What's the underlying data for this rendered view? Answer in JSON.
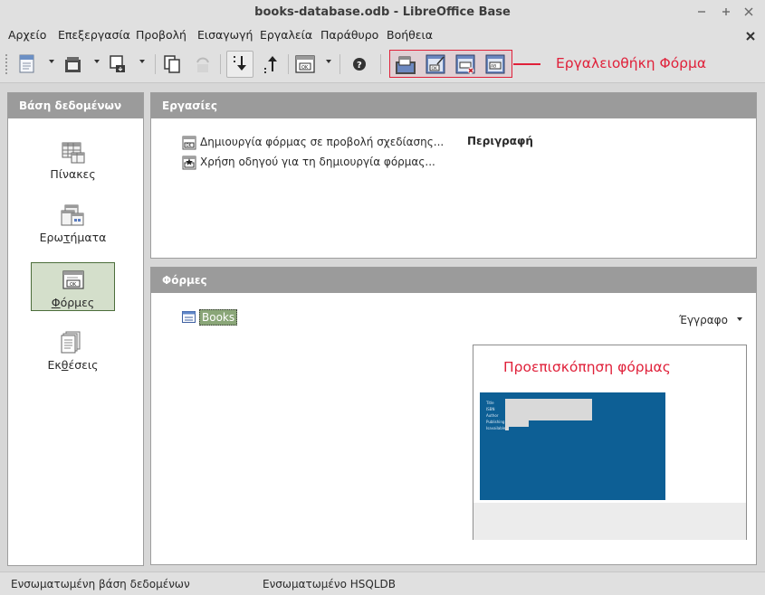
{
  "window": {
    "title": "books-database.odb - LibreOffice Base"
  },
  "menu": {
    "items": [
      "Αρχείο",
      "Επεξεργασία",
      "Προβολή",
      "Εισαγωγή",
      "Εργαλεία",
      "Παράθυρο",
      "Βοήθεια"
    ]
  },
  "toolbar": {
    "annotation": "Εργαλειοθήκη Φόρμα",
    "annotation_color": "#e0213a"
  },
  "database_panel": {
    "header": "Βάση δεδομένων",
    "categories": [
      {
        "label": "Πίνακες",
        "icon": "tables-icon",
        "selected": false
      },
      {
        "label": "Ερωτήματα",
        "icon": "queries-icon",
        "selected": false
      },
      {
        "label": "Φόρμες",
        "icon": "forms-icon",
        "selected": true
      },
      {
        "label": "Εκθέσεις",
        "icon": "reports-icon",
        "selected": false
      }
    ]
  },
  "tasks_panel": {
    "header": "Εργασίες",
    "items": [
      "Δημιουργία φόρμας σε προβολή σχεδίασης...",
      "Χρήση οδηγού για τη δημιουργία φόρμας..."
    ],
    "description_label": "Περιγραφή"
  },
  "forms_panel": {
    "header": "Φόρμες",
    "items": [
      "Books"
    ],
    "preview_mode": "Έγγραφο",
    "preview_annotation": "Προεπισκόπηση φόρμας",
    "preview_fields": [
      "Title",
      "ISBN",
      "Author",
      "Publishing",
      "Isavailable"
    ]
  },
  "statusbar": {
    "database_type": "Ενσωματωμένη βάση δεδομένων",
    "engine": "Ενσωματωμένο HSQLDB"
  },
  "colors": {
    "header_bg": "#9b9b9b",
    "selected_bg": "#d4dfcb",
    "form_preview_bg": "#0d5f95"
  }
}
